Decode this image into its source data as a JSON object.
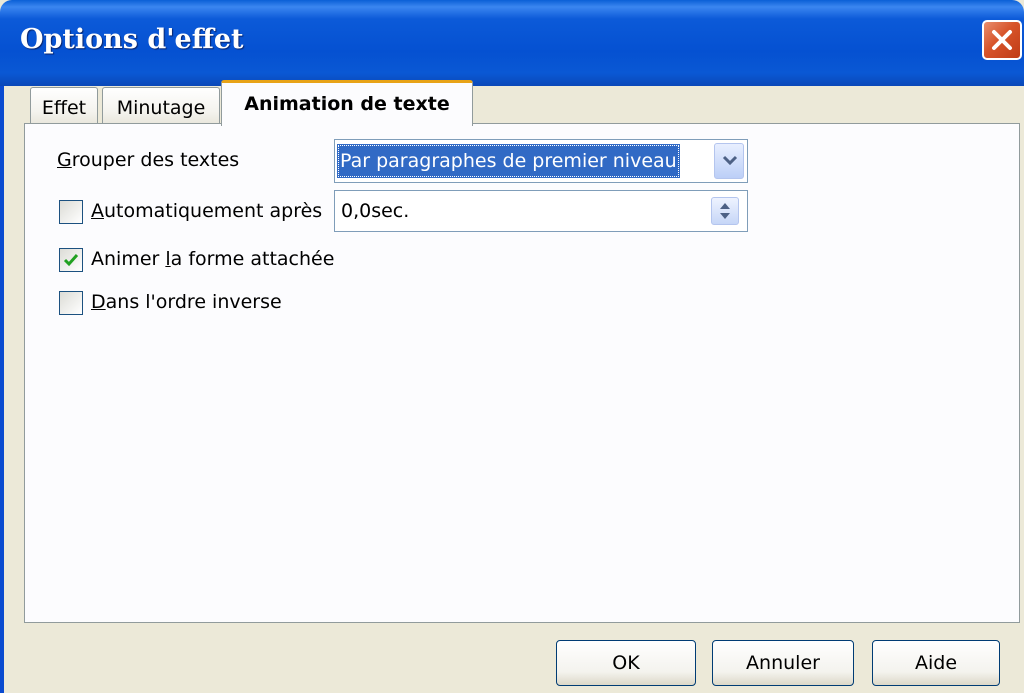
{
  "window": {
    "title": "Options d'effet"
  },
  "tabs": [
    {
      "label": "Effet",
      "active": false
    },
    {
      "label": "Minutage",
      "active": false
    },
    {
      "label": "Animation de texte",
      "active": true
    }
  ],
  "group_text": {
    "label_mnemonic": "G",
    "label_rest": "rouper des textes",
    "selected": "Par paragraphes de premier niveau"
  },
  "auto_after": {
    "label_mnemonic": "A",
    "label_rest": "utomatiquement après",
    "checked": false,
    "value": "0,0sec."
  },
  "animate_shape": {
    "label_before": "Animer ",
    "label_mnemonic": "l",
    "label_after": "a forme attachée",
    "checked": true
  },
  "reverse_order": {
    "label_mnemonic": "D",
    "label_rest": "ans l'ordre inverse",
    "checked": false
  },
  "buttons": {
    "ok": "OK",
    "cancel": "Annuler",
    "help": "Aide"
  },
  "icons": {
    "close": "close-icon",
    "dropdown": "chevron-down-icon",
    "spin": "spin-arrows-icon",
    "check": "checkmark-icon"
  },
  "colors": {
    "titlebar": "#0551d2",
    "close_button": "#d7542a",
    "selection": "#316ac5",
    "active_tab_accent": "#e8a317",
    "check_mark": "#21a121"
  }
}
